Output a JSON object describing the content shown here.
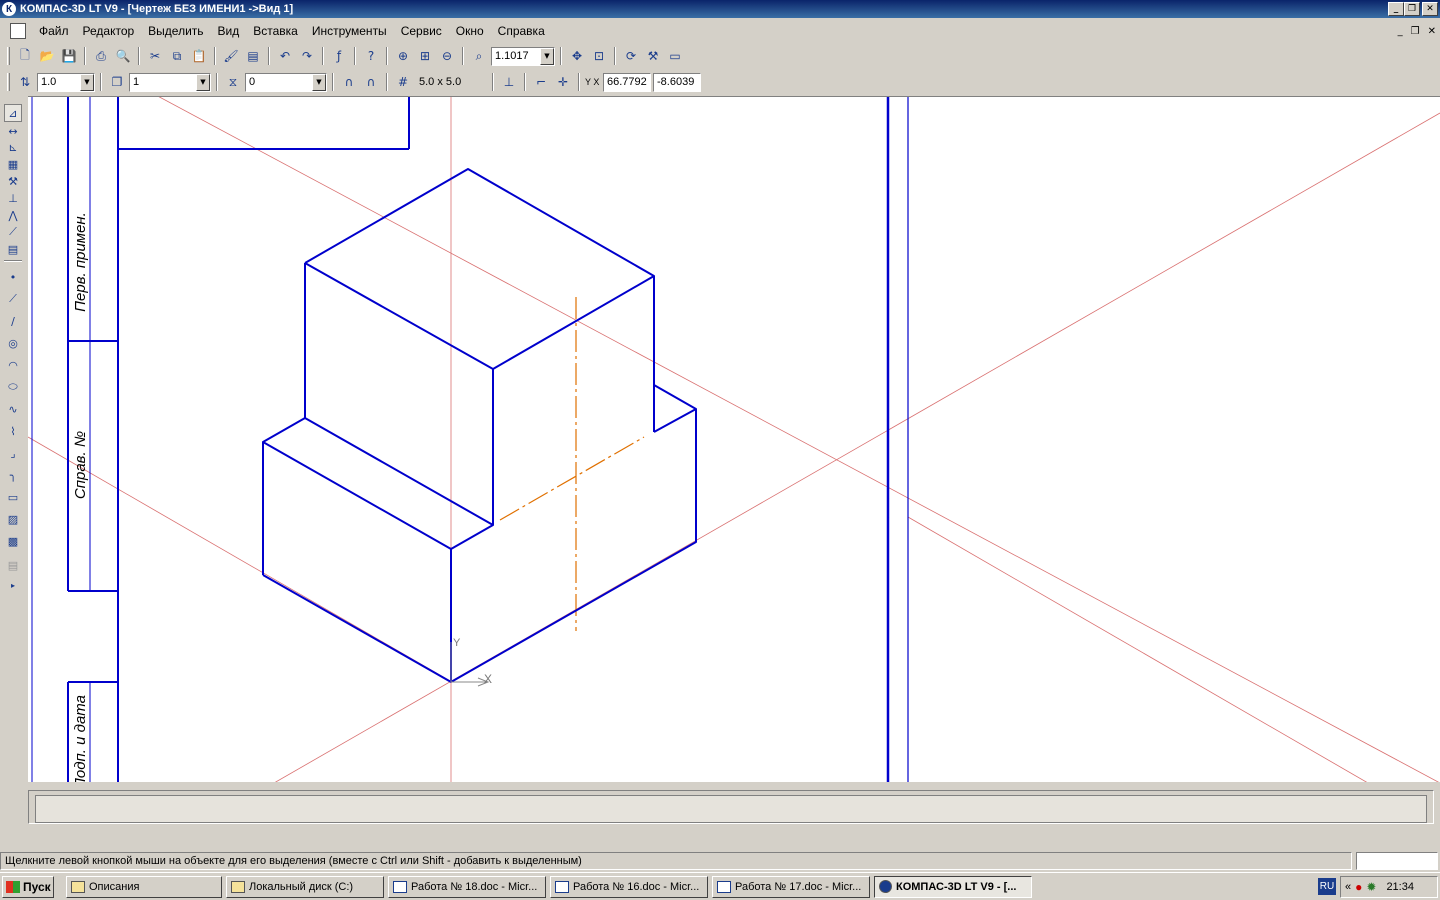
{
  "window": {
    "title": "КОМПАС-3D LT V9 - [Чертеж БЕЗ ИМЕНИ1 ->Вид 1]",
    "app_icon": "К"
  },
  "menu": [
    {
      "label": "Файл"
    },
    {
      "label": "Редактор"
    },
    {
      "label": "Выделить"
    },
    {
      "label": "Вид"
    },
    {
      "label": "Вставка"
    },
    {
      "label": "Инструменты"
    },
    {
      "label": "Сервис"
    },
    {
      "label": "Окно"
    },
    {
      "label": "Справка"
    }
  ],
  "toolbar1": {
    "zoom_value": "1.1017"
  },
  "toolbar2": {
    "step_value": "1.0",
    "layer_value": "1",
    "style_value": "0",
    "grid_value": "5.0 x 5.0",
    "coord_label": "Y X",
    "coord_x": "66.7792",
    "coord_y": "-8.6039"
  },
  "drawing": {
    "frame_labels": {
      "perv_primen": "Перв. примен.",
      "sprav_no": "Справ. №",
      "podp_data": "Подп. и дата"
    },
    "axis_y": "Y",
    "axis_x": "X",
    "colors": {
      "main_line": "#0000cc",
      "center_line": "#e07000",
      "aux_line": "#d06060",
      "frame_line": "#0000cc"
    }
  },
  "status": {
    "message": "Щелкните левой кнопкой мыши на объекте для его выделения (вместе с Ctrl или Shift - добавить к выделенным)"
  },
  "taskbar": {
    "start_label": "Пуск",
    "items": [
      {
        "label": "Описания",
        "icon": "folder-icon"
      },
      {
        "label": "Локальный диск (C:)",
        "icon": "folder-icon"
      },
      {
        "label": "Работа № 18.doc - Micr...",
        "icon": "word-icon"
      },
      {
        "label": "Работа № 16.doc - Micr...",
        "icon": "word-icon"
      },
      {
        "label": "Работа № 17.doc - Micr...",
        "icon": "word-icon"
      },
      {
        "label": "КОМПАС-3D LT V9 - [...",
        "icon": "kompas-icon"
      }
    ],
    "lang": "RU",
    "clock": "21:34",
    "tray_chevron": "«"
  }
}
